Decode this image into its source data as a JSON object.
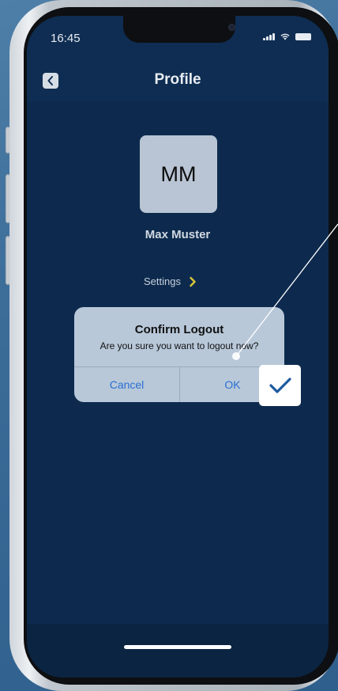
{
  "status_bar": {
    "time": "16:45"
  },
  "nav": {
    "title": "Profile"
  },
  "profile": {
    "initials": "MM",
    "name": "Max Muster",
    "settings_label": "Settings"
  },
  "dialog": {
    "title": "Confirm Logout",
    "message": "Are you sure you want to logout now?",
    "cancel_label": "Cancel",
    "ok_label": "OK"
  },
  "colors": {
    "screen_background": "#0d2a4e",
    "accent_chevron": "#d7c63a",
    "dialog_button_text": "#2a6fd1",
    "check_mark": "#1e5aa0"
  },
  "icons": {
    "back": "chevron-left-icon",
    "settings_arrow": "chevron-right-icon",
    "confirm_badge": "checkmark-icon"
  }
}
